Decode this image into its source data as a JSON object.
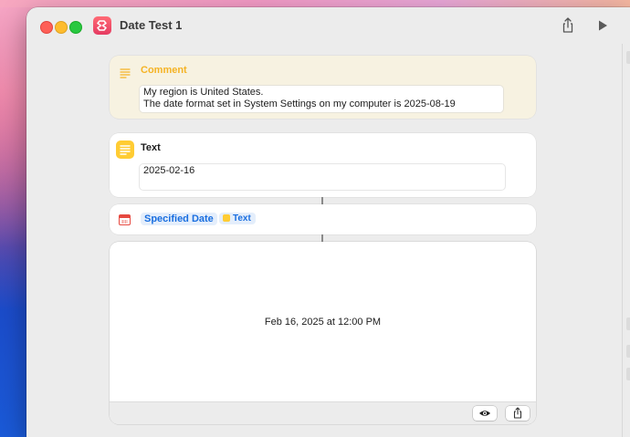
{
  "window": {
    "title": "Date Test 1"
  },
  "comment": {
    "label": "Comment",
    "line1": "My region is United States.",
    "line2": "The date format set in System Settings on my computer is 2025-08-19"
  },
  "text_action": {
    "label": "Text",
    "value": "2025-02-16"
  },
  "date_action": {
    "label": "Specified Date",
    "variable": "Text"
  },
  "result": {
    "value": "Feb 16, 2025 at 12:00 PM"
  },
  "colors": {
    "comment_accent": "#f5b324",
    "link_blue": "#1a6fe0",
    "text_icon": "#ffcc33",
    "calendar_red": "#e64940"
  },
  "icons": [
    "comment-icon",
    "text-icon",
    "calendar-icon",
    "eye-icon",
    "share-icon",
    "play-icon"
  ]
}
